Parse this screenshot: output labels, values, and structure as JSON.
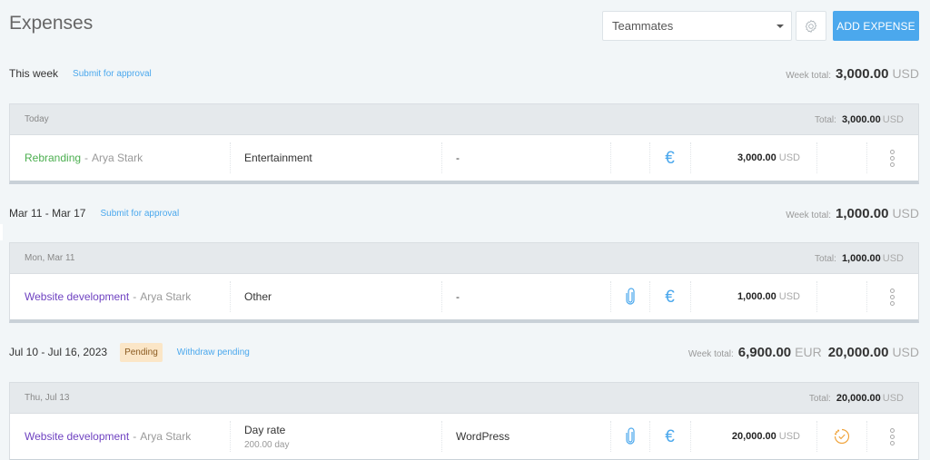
{
  "header": {
    "title": "Expenses",
    "filter": {
      "selected": "Teammates"
    },
    "settings_icon": "gear-icon",
    "add_button_label": "ADD EXPENSE"
  },
  "weeks": [
    {
      "label": "This week",
      "action_link": "Submit for approval",
      "status_badge": null,
      "total_label": "Week total:",
      "totals": [
        {
          "amount": "3,000.00",
          "currency": "USD"
        }
      ],
      "days": [
        {
          "label": "Today",
          "total_label": "Total:",
          "total_amount": "3,000.00",
          "total_currency": "USD",
          "expenses": [
            {
              "project": "Rebranding",
              "project_color": "#4caf50",
              "separator": "-",
              "user": "Arya Stark",
              "category": "Entertainment",
              "category_sub": "",
              "note": "-",
              "has_attachment": false,
              "billable_icon": "euro-icon",
              "amount": "3,000.00",
              "currency": "USD",
              "status_icon": null,
              "menu_icon": "more-vertical-icon"
            }
          ]
        }
      ]
    },
    {
      "label": "Mar 11 - Mar 17",
      "action_link": "Submit for approval",
      "status_badge": null,
      "total_label": "Week total:",
      "totals": [
        {
          "amount": "1,000.00",
          "currency": "USD"
        }
      ],
      "days": [
        {
          "label": "Mon, Mar 11",
          "total_label": "Total:",
          "total_amount": "1,000.00",
          "total_currency": "USD",
          "expenses": [
            {
              "project": "Website development",
              "project_color": "#6f42c1",
              "separator": "-",
              "user": "Arya Stark",
              "category": "Other",
              "category_sub": "",
              "note": "-",
              "has_attachment": true,
              "billable_icon": "euro-icon",
              "amount": "1,000.00",
              "currency": "USD",
              "status_icon": null,
              "menu_icon": "more-vertical-icon"
            }
          ]
        }
      ]
    },
    {
      "label": "Jul 10 - Jul 16, 2023",
      "action_link": "Withdraw pending",
      "status_badge": "Pending",
      "total_label": "Week total:",
      "totals": [
        {
          "amount": "6,900.00",
          "currency": "EUR"
        },
        {
          "amount": "20,000.00",
          "currency": "USD"
        }
      ],
      "days": [
        {
          "label": "Thu, Jul 13",
          "total_label": "Total:",
          "total_amount": "20,000.00",
          "total_currency": "USD",
          "expenses": [
            {
              "project": "Website development",
              "project_color": "#6f42c1",
              "separator": "-",
              "user": "Arya Stark",
              "category": "Day rate",
              "category_sub": "200.00 day",
              "note": "WordPress",
              "has_attachment": true,
              "billable_icon": "euro-icon",
              "amount": "20,000.00",
              "currency": "USD",
              "status_icon": "pending-approval-icon",
              "menu_icon": "more-vertical-icon"
            }
          ]
        }
      ]
    }
  ],
  "colors": {
    "accent": "#4ba8ed",
    "pending_badge_bg": "#fbe6c7",
    "pending_icon": "#f0a43c",
    "background": "#f2f6f8"
  }
}
